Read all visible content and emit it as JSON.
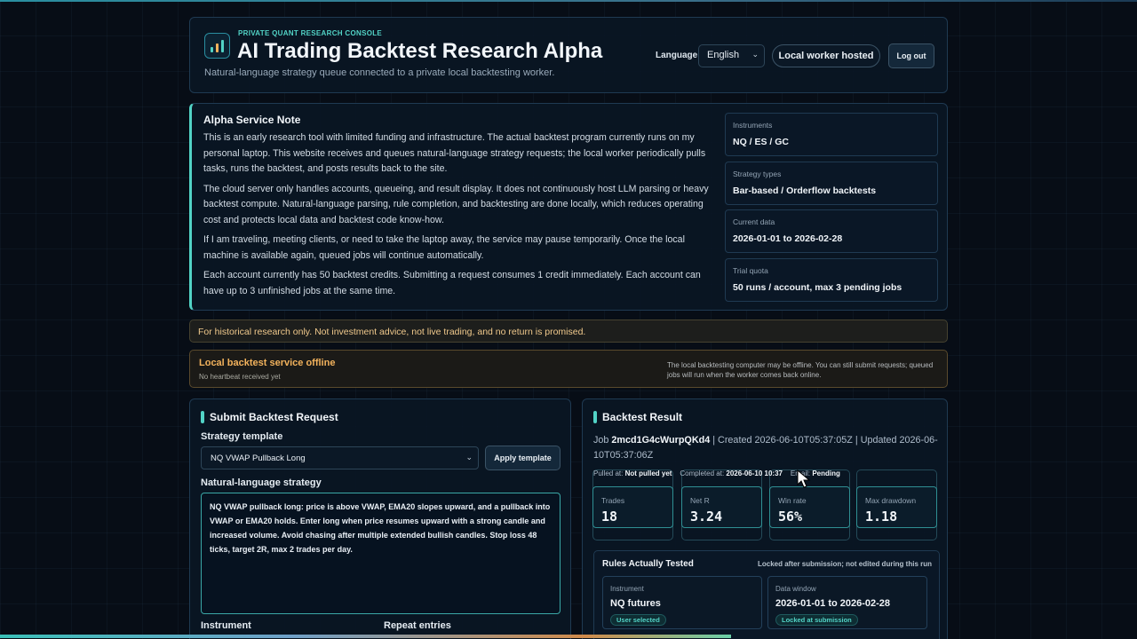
{
  "header": {
    "eyebrow": "PRIVATE QUANT RESEARCH CONSOLE",
    "title": "AI Trading Backtest Research Alpha",
    "subtitle": "Natural-language strategy queue connected to a private local backtesting worker.",
    "language_label": "Language",
    "language_value": "English",
    "hosted_label": "Local worker hosted",
    "logout_label": "Log out"
  },
  "note": {
    "title": "Alpha Service Note",
    "paragraphs": [
      "This is an early research tool with limited funding and infrastructure. The actual backtest program currently runs on my personal laptop. This website receives and queues natural-language strategy requests; the local worker periodically pulls tasks, runs the backtest, and posts results back to the site.",
      "The cloud server only handles accounts, queueing, and result display. It does not continuously host LLM parsing or heavy backtest compute. Natural-language parsing, rule completion, and backtesting are done locally, which reduces operating cost and protects local data and backtest code know-how.",
      "If I am traveling, meeting clients, or need to take the laptop away, the service may pause temporarily. Once the local machine is available again, queued jobs will continue automatically.",
      "Each account currently has 50 backtest credits. Submitting a request consumes 1 credit immediately. Each account can have up to 3 unfinished jobs at the same time."
    ],
    "cards": [
      {
        "label": "Instruments",
        "value": "NQ / ES / GC"
      },
      {
        "label": "Strategy types",
        "value": "Bar-based / Orderflow backtests"
      },
      {
        "label": "Current data",
        "value": "2026-01-01 to 2026-02-28"
      },
      {
        "label": "Trial quota",
        "value": "50 runs / account, max 3 pending jobs"
      }
    ]
  },
  "disclaimer": "For historical research only. Not investment advice, not live trading, and no return is promised.",
  "offline": {
    "title": "Local backtest service offline",
    "subtitle": "No heartbeat received yet",
    "description": "The local backtesting computer may be offline. You can still submit requests; queued jobs will run when the worker comes back online."
  },
  "submit": {
    "title": "Submit Backtest Request",
    "template_label": "Strategy template",
    "template_value": "NQ VWAP Pullback Long",
    "apply_label": "Apply template",
    "strategy_label": "Natural-language strategy",
    "strategy_text": "NQ VWAP pullback long: price is above VWAP, EMA20 slopes upward, and a pullback into VWAP or EMA20 holds. Enter long when price resumes upward with a strong candle and increased volume. Avoid chasing after multiple extended bullish candles. Stop loss 48 ticks, target 2R, max 2 trades per day.",
    "instrument_label": "Instrument",
    "repeat_label": "Repeat entries"
  },
  "result": {
    "title": "Backtest Result",
    "job_prefix": "Job ",
    "job_id": "2mcd1G4cWurpQKd4",
    "job_rest": " | Created 2026-06-10T05:37:05Z | Updated 2026-06-10T05:37:06Z",
    "pulled_label": "Pulled at: ",
    "pulled_value": "Not pulled yet",
    "completed_label": "Completed at: ",
    "completed_value": "2026-06-10 10:37",
    "email_label": "Email: ",
    "email_value": "Pending",
    "metrics": [
      {
        "label": "Trades",
        "value": "18"
      },
      {
        "label": "Net R",
        "value": "3.24"
      },
      {
        "label": "Win rate",
        "value": "56%"
      },
      {
        "label": "Max drawdown",
        "value": "1.18"
      }
    ],
    "rules_title": "Rules Actually Tested",
    "rules_note": "Locked after submission; not edited during this run",
    "rule_cards": [
      {
        "label": "Instrument",
        "value": "NQ futures",
        "badge": "User selected"
      },
      {
        "label": "Data window",
        "value": "2026-01-01 to 2026-02-28",
        "badge": "Locked at submission"
      }
    ]
  },
  "colors": {
    "accent": "#52d3c6",
    "warning": "#f2b25c",
    "background": "#070d16"
  }
}
